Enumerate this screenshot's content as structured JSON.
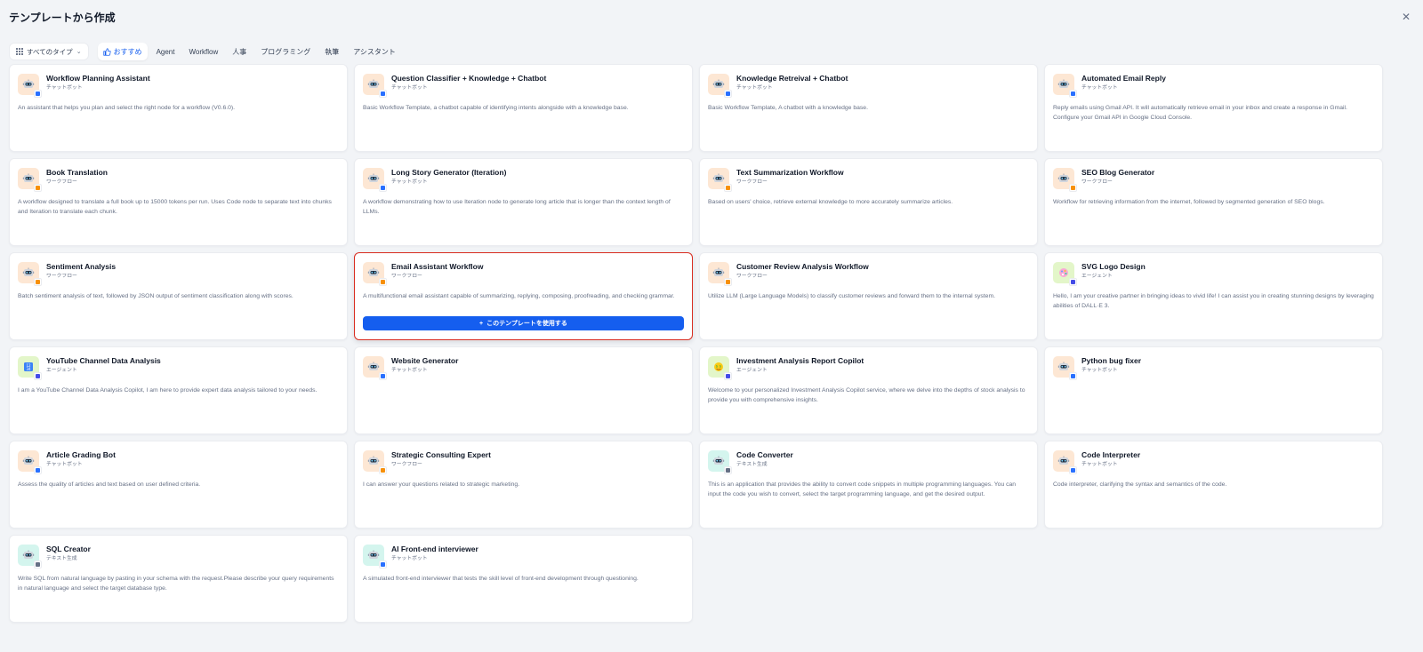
{
  "header": {
    "title": "テンプレートから作成",
    "close_glyph": "✕"
  },
  "filters": {
    "type_select": "すべてのタイプ",
    "tabs": [
      "おすすめ",
      "Agent",
      "Workflow",
      "人事",
      "プログラミング",
      "執筆",
      "アシスタント"
    ],
    "active_tab": 0
  },
  "colors": {
    "accent": "#155eef",
    "hover_border": "#d92d20",
    "chatbot_badge": "#2970ff",
    "workflow_badge": "#f79009",
    "agent_badge": "#444ce7",
    "text_badge": "#667085"
  },
  "use_button": {
    "label": "このテンプレートを使用する",
    "icon": "plus-icon"
  },
  "cards": [
    {
      "title": "Workflow Planning Assistant",
      "type": "チャットボット",
      "mode": "chatbot",
      "icon": "robot-icon",
      "bg": "#fde7d4",
      "desc": "An assistant that helps you plan and select the right node for a workflow (V0.6.0)."
    },
    {
      "title": "Question Classifier + Knowledge + Chatbot",
      "type": "チャットボット",
      "mode": "chatbot",
      "icon": "robot-icon",
      "bg": "#fde7d4",
      "desc": "Basic Workflow Template, a chatbot capable of identifying intents alongside with a knowledge base."
    },
    {
      "title": "Knowledge Retreival + Chatbot",
      "type": "チャットボット",
      "mode": "chatbot",
      "icon": "robot-icon",
      "bg": "#fde7d4",
      "desc": "Basic Workflow Template, A chatbot with a knowledge base."
    },
    {
      "title": "Automated Email Reply",
      "type": "チャットボット",
      "mode": "chatbot",
      "icon": "robot-icon",
      "bg": "#fde7d4",
      "desc": "Reply emails using Gmail API. It will automatically retrieve email in your inbox and create a response in Gmail. Configure your Gmail API in Google Cloud Console."
    },
    {
      "title": "Book Translation",
      "type": "ワークフロー",
      "mode": "workflow",
      "icon": "robot-icon",
      "bg": "#fde7d4",
      "desc": "A workflow designed to translate a full book up to 15000 tokens per run. Uses Code node to separate text into chunks and Iteration to translate each chunk."
    },
    {
      "title": "Long Story Generator (Iteration)",
      "type": "チャットボット",
      "mode": "chatbot",
      "icon": "robot-icon",
      "bg": "#fde7d4",
      "desc": "A workflow demonstrating how to use Iteration node to generate long article that is longer than the context length of LLMs."
    },
    {
      "title": "Text Summarization Workflow",
      "type": "ワークフロー",
      "mode": "workflow",
      "icon": "robot-icon",
      "bg": "#fde7d4",
      "desc": "Based on users' choice, retrieve external knowledge to more accurately summarize articles."
    },
    {
      "title": "SEO Blog Generator",
      "type": "ワークフロー",
      "mode": "workflow",
      "icon": "robot-icon",
      "bg": "#fde7d4",
      "desc": "Workflow for retrieving information from the internet, followed by segmented generation of SEO blogs."
    },
    {
      "title": "Sentiment Analysis",
      "type": "ワークフロー",
      "mode": "workflow",
      "icon": "robot-icon",
      "bg": "#fde7d4",
      "desc": "Batch sentiment analysis of text, followed by JSON output of sentiment classification along with scores."
    },
    {
      "title": "Email Assistant Workflow",
      "type": "ワークフロー",
      "mode": "workflow",
      "icon": "robot-icon",
      "bg": "#fde7d4",
      "desc": "A multifunctional email assistant capable of summarizing, replying, composing, proofreading, and checking grammar.",
      "hover": true
    },
    {
      "title": "Customer Review Analysis Workflow",
      "type": "ワークフロー",
      "mode": "workflow",
      "icon": "robot-icon",
      "bg": "#fde7d4",
      "desc": "Utilize LLM (Large Language Models) to classify customer reviews and forward them to the internal system."
    },
    {
      "title": "SVG Logo Design",
      "type": "エージェント",
      "mode": "agent",
      "icon": "palette-icon",
      "bg": "#e3f6c9",
      "desc": "Hello, I am your creative partner in bringing ideas to vivid life! I can assist you in creating stunning designs by leveraging abilities of DALL·E 3."
    },
    {
      "title": "YouTube Channel Data Analysis",
      "type": "エージェント",
      "mode": "agent",
      "icon": "numbers-icon",
      "bg": "#e3f6c9",
      "desc": "I am a YouTube Channel Data Analysis Copilot, I am here to provide expert data analysis tailored to your needs."
    },
    {
      "title": "Website Generator",
      "type": "チャットボット",
      "mode": "chatbot",
      "icon": "robot-icon",
      "bg": "#fde7d4",
      "desc": ""
    },
    {
      "title": "Investment Analysis Report Copilot",
      "type": "エージェント",
      "mode": "agent",
      "icon": "money-face-icon",
      "bg": "#e3f6c9",
      "desc": "Welcome to your personalized Investment Analysis Copilot service, where we delve into the depths of stock analysis to provide you with comprehensive insights."
    },
    {
      "title": "Python bug fixer",
      "type": "チャットボット",
      "mode": "chatbot",
      "icon": "robot-icon",
      "bg": "#fde7d4",
      "desc": ""
    },
    {
      "title": "Article Grading Bot",
      "type": "チャットボット",
      "mode": "chatbot",
      "icon": "robot-icon",
      "bg": "#fde7d4",
      "desc": "Assess the quality of articles and text based on user defined criteria."
    },
    {
      "title": "Strategic Consulting Expert",
      "type": "ワークフロー",
      "mode": "workflow",
      "icon": "robot-icon",
      "bg": "#fde7d4",
      "desc": "I can answer your questions related to strategic marketing."
    },
    {
      "title": "Code Converter",
      "type": "テキスト生成",
      "mode": "text",
      "icon": "robot-icon",
      "bg": "#d4f5ee",
      "desc": "This is an application that provides the ability to convert code snippets in multiple programming languages. You can input the code you wish to convert, select the target programming language, and get the desired output."
    },
    {
      "title": "Code Interpreter",
      "type": "チャットボット",
      "mode": "chatbot",
      "icon": "robot-icon",
      "bg": "#fde7d4",
      "desc": "Code interpreter, clarifying the syntax and semantics of the code."
    },
    {
      "title": "SQL Creator",
      "type": "テキスト生成",
      "mode": "text",
      "icon": "robot-icon",
      "bg": "#d4f5ee",
      "desc": "Write SQL from natural language by pasting in your schema with the request.Please describe your query requirements in natural language and select the target database type."
    },
    {
      "title": "AI Front-end interviewer",
      "type": "チャットボット",
      "mode": "chatbot",
      "icon": "robot-icon",
      "bg": "#d4f5ee",
      "desc": "A simulated front-end interviewer that tests the skill level of front-end development through questioning."
    }
  ]
}
